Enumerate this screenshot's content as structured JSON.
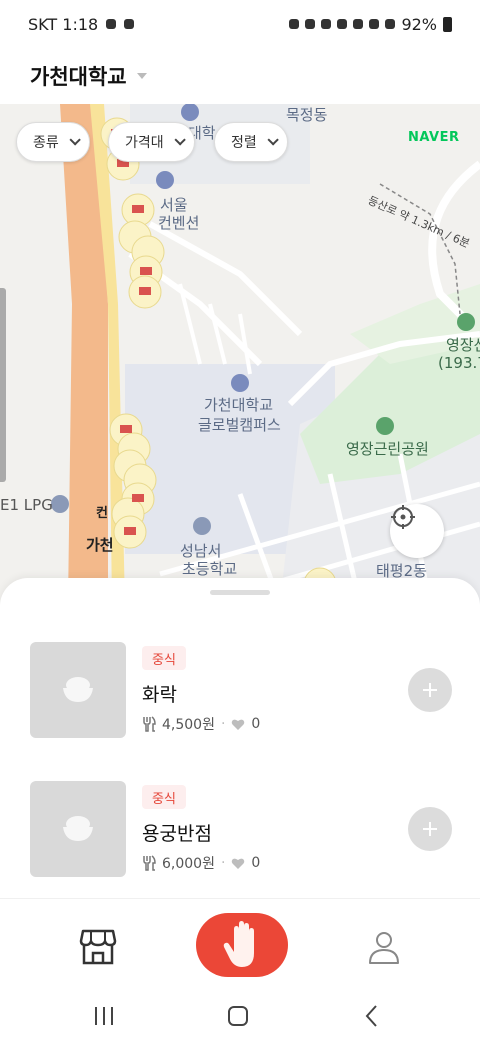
{
  "status_bar": {
    "carrier_time": "SKT 1:18",
    "battery": "92%"
  },
  "header": {
    "title": "가천대학교"
  },
  "map": {
    "provider": "NAVER",
    "labels": {
      "mokjeong": "목정동",
      "university_top": "대학",
      "seoul": "서울",
      "convention": "컨벤션",
      "gachon": "가천대학교",
      "global_campus": "글로벌캠퍼스",
      "park": "영장근린공원",
      "mountain": "영장산",
      "elevation": "(193.7",
      "lpg": "E1 LPG",
      "seongnam": "성남서",
      "elementary": "초등학교",
      "taepyeong": "태평2동",
      "ga": "가천",
      "k": "컨"
    },
    "trail": "등산로 약 1.3km / 6분"
  },
  "filters": [
    {
      "label": "종류"
    },
    {
      "label": "가격대"
    },
    {
      "label": "정렬"
    }
  ],
  "stores": [
    {
      "category": "중식",
      "name": "화락",
      "price": "4,500원",
      "likes": "0"
    },
    {
      "category": "중식",
      "name": "용궁반점",
      "price": "6,000원",
      "likes": "0"
    }
  ],
  "colors": {
    "accent": "#eb4737",
    "badge_bg": "#fdeeee",
    "naver_green": "#03c75a"
  },
  "icons": {
    "store_tab": "storefront-icon",
    "center_tab": "hand-icon",
    "profile_tab": "person-icon"
  }
}
